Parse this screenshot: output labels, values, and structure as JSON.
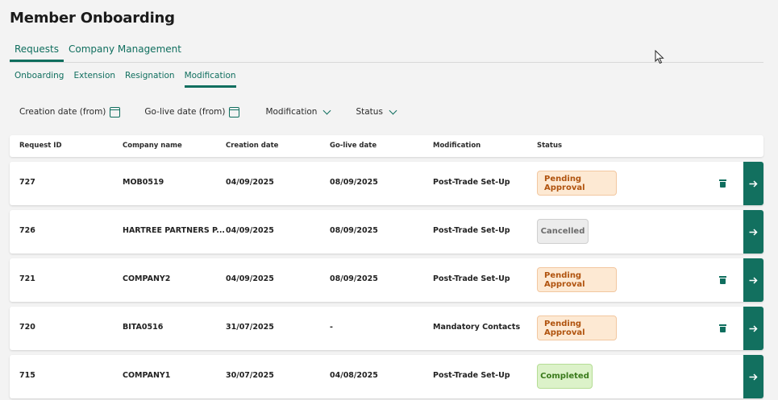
{
  "page_title": "Member Onboarding",
  "main_tabs": [
    {
      "label": "Requests",
      "active": true
    },
    {
      "label": "Company Management",
      "active": false
    }
  ],
  "sub_tabs": [
    {
      "label": "Onboarding",
      "active": false
    },
    {
      "label": "Extension",
      "active": false
    },
    {
      "label": "Resignation",
      "active": false
    },
    {
      "label": "Modification",
      "active": true
    }
  ],
  "filters": {
    "creation_date": "Creation date (from)",
    "golive_date": "Go-live date (from)",
    "modification": "Modification",
    "status": "Status"
  },
  "columns": [
    "Request ID",
    "Company name",
    "Creation date",
    "Go-live date",
    "Modification",
    "Status"
  ],
  "rows": [
    {
      "id": "727",
      "company": "MOB0519",
      "created": "04/09/2025",
      "golive": "08/09/2025",
      "modification": "Post-Trade Set-Up",
      "status": "Pending Approval",
      "status_type": "pending",
      "deletable": true
    },
    {
      "id": "726",
      "company": "HARTREE PARTNERS P...",
      "created": "04/09/2025",
      "golive": "08/09/2025",
      "modification": "Post-Trade Set-Up",
      "status": "Cancelled",
      "status_type": "cancelled",
      "deletable": false
    },
    {
      "id": "721",
      "company": "COMPANY2",
      "created": "04/09/2025",
      "golive": "08/09/2025",
      "modification": "Post-Trade Set-Up",
      "status": "Pending Approval",
      "status_type": "pending",
      "deletable": true
    },
    {
      "id": "720",
      "company": "BITA0516",
      "created": "31/07/2025",
      "golive": "-",
      "modification": "Mandatory Contacts",
      "status": "Pending Approval",
      "status_type": "pending",
      "deletable": true
    },
    {
      "id": "715",
      "company": "COMPANY1",
      "created": "30/07/2025",
      "golive": "04/08/2025",
      "modification": "Post-Trade Set-Up",
      "status": "Completed",
      "status_type": "completed",
      "deletable": false
    }
  ],
  "colors": {
    "accent": "#0f6e5e",
    "pending": "#b0530e",
    "completed": "#3a7a1b",
    "cancelled": "#6b6b6b"
  }
}
